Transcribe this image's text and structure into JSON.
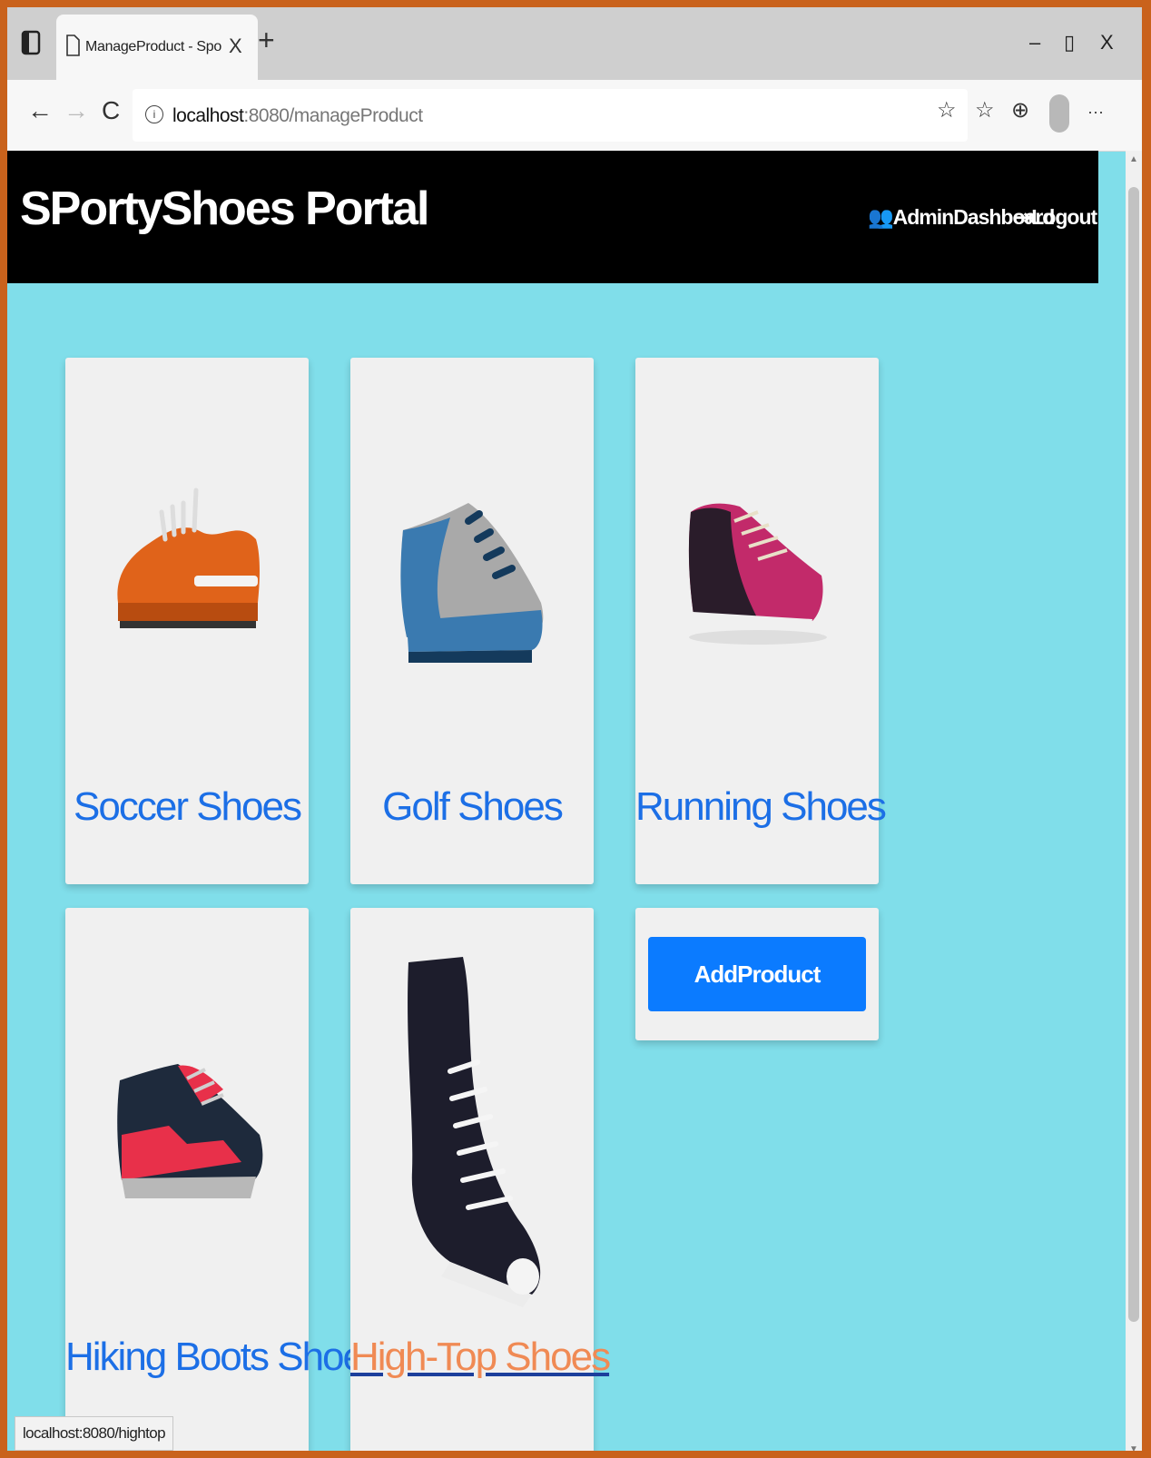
{
  "browser": {
    "tab_title": "ManageProduct - SportyShoes.c",
    "tab_close": "X",
    "new_tab": "+",
    "minimize": "–",
    "restore": "▯",
    "close": "X",
    "back": "←",
    "forward": "→",
    "refresh": "C",
    "info": "i",
    "url_host": "localhost",
    "url_path": ":8080/manageProduct",
    "more": "···",
    "status_url": "localhost:8080/hightop"
  },
  "site": {
    "brand": "SPortyShoes Portal",
    "nav": {
      "admin_dashboard": "AdminDashboard",
      "logout": "Logout"
    }
  },
  "products": [
    {
      "label": "Soccer Shoes",
      "image": "orange-soccer-shoe"
    },
    {
      "label": "Golf Shoes",
      "image": "gray-blue-golf-shoe"
    },
    {
      "label": "Running Shoes",
      "image": "magenta-running-shoe"
    },
    {
      "label": "Hiking Boots Shoes",
      "image": "navy-red-hiking-shoe"
    },
    {
      "label": "High-Top Shoes",
      "image": "black-high-top-sneaker"
    }
  ],
  "add_product_label": "AddProduct",
  "colors": {
    "page_background": "#80deea",
    "navbar": "#000000",
    "link": "#1c6fe6",
    "link_hover": "#f08a54",
    "button": "#0b7bff",
    "window_border": "#c9621c"
  }
}
